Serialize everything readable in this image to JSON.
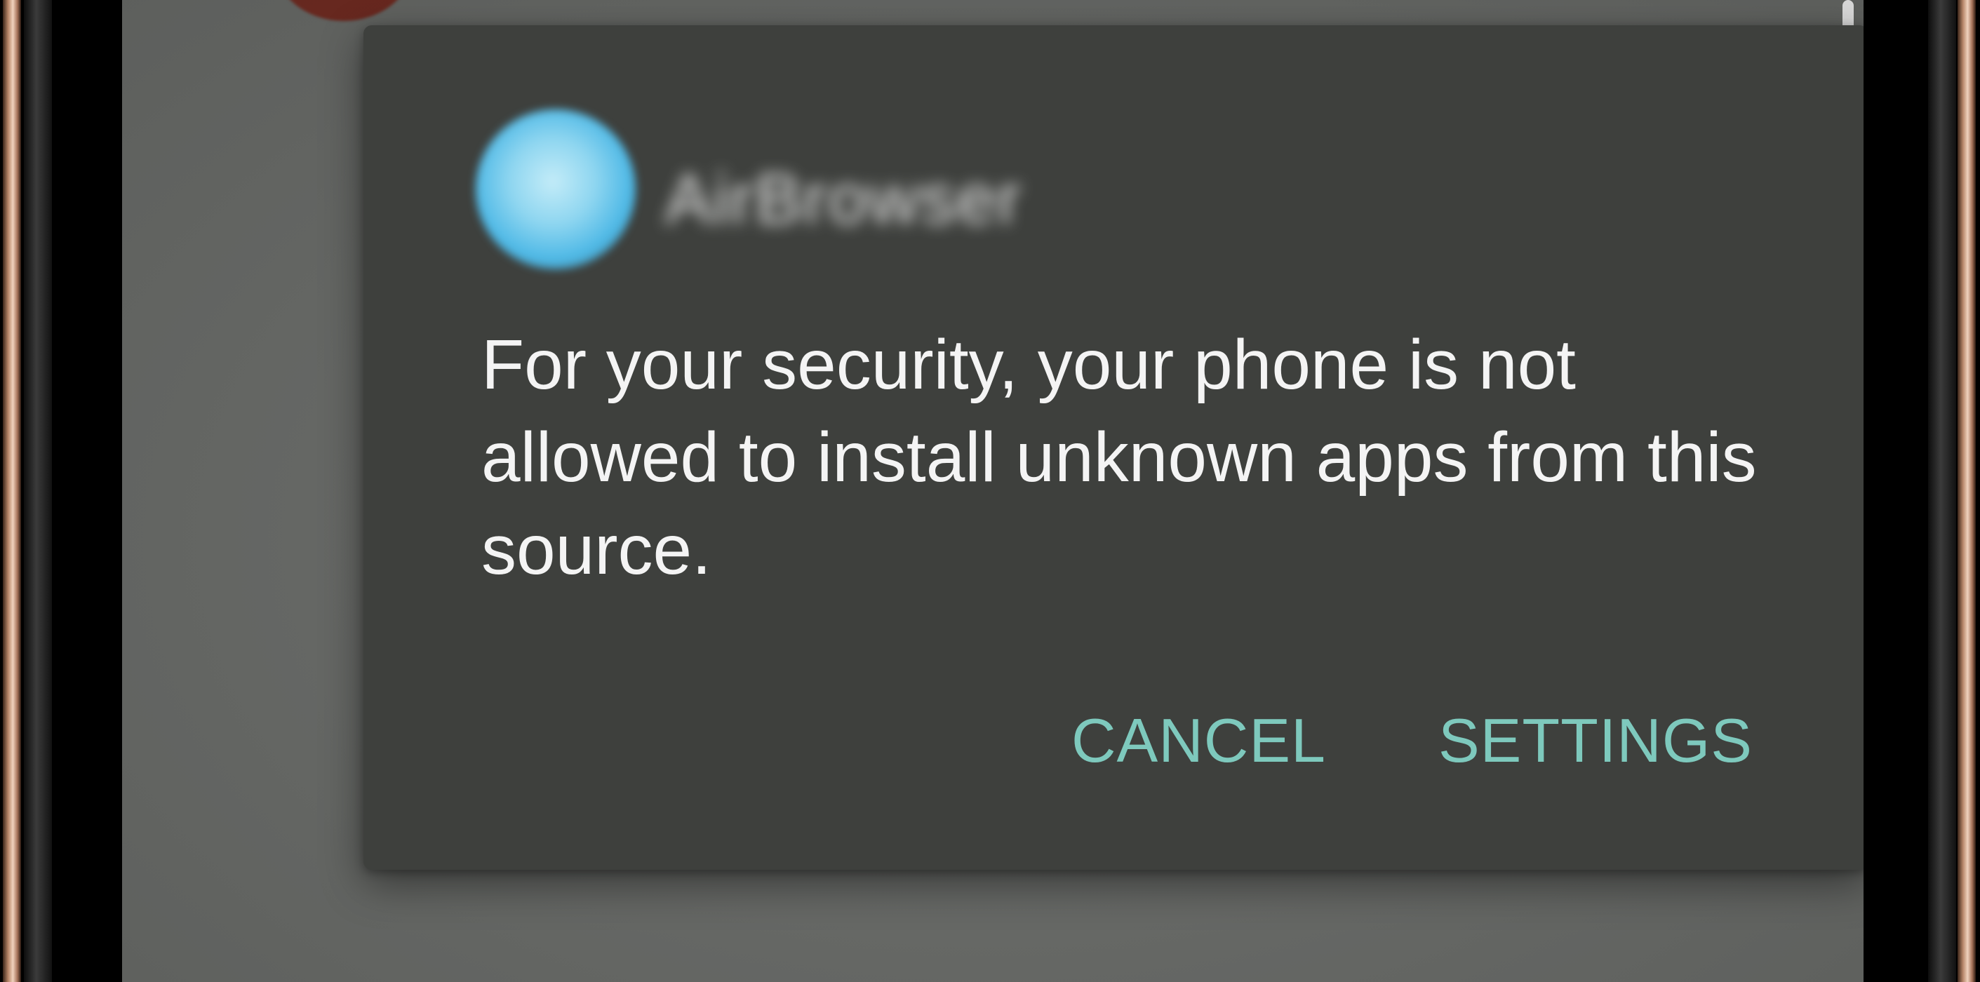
{
  "dialog": {
    "app_name": "AirBrowser",
    "message": "For your security, your phone is not allowed to install unknown apps from this source.",
    "buttons": {
      "cancel": "CANCEL",
      "settings": "SETTINGS"
    }
  },
  "colors": {
    "dialog_background": "#3e403d",
    "screen_dim": "#6f716e",
    "accent": "#7ec9bd",
    "message_text": "#f4f4f4",
    "app_icon": "#6cc9ee",
    "frame": "#d8a88c"
  },
  "icons": {
    "app_icon": "app-icon"
  }
}
